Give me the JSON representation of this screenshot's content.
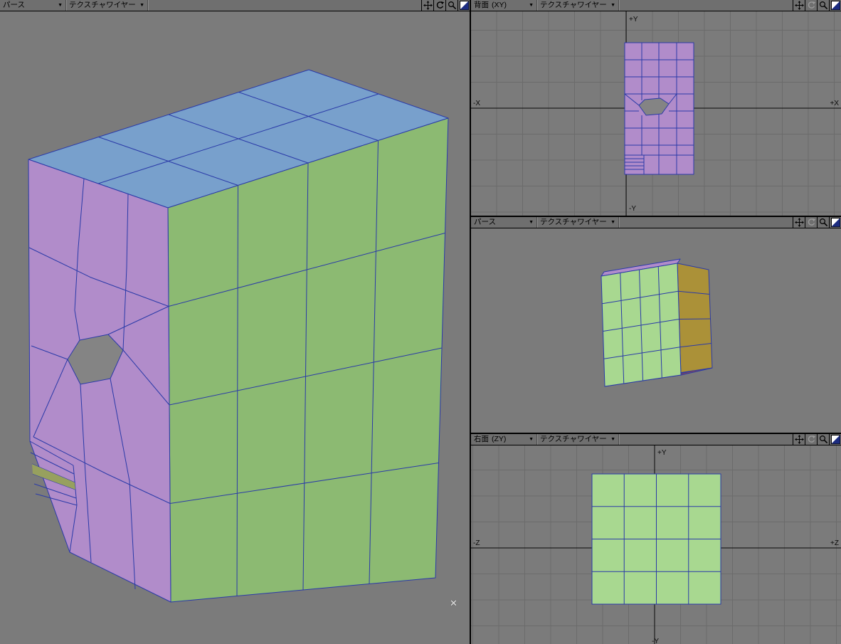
{
  "colors": {
    "viewport_bg": "#7b7b7b",
    "header_bg": "#6f6f6f",
    "grid_line": "#6b6b6b",
    "wire": "#2a3aa8",
    "axis": "#0a0a0a",
    "face_purple": "#b18cca",
    "face_blue": "#78a0cc",
    "face_green": "#8cba72",
    "face_light_green": "#a8d890",
    "face_olive": "#ab9138",
    "face_red": "#94494b",
    "hole_gray": "#848484",
    "stair_sliver": "#97a05e"
  },
  "icons": {
    "dropdown_arrow": "▼"
  },
  "cursor_mark": "✕",
  "viewports": {
    "perspective_main": {
      "view_label": "パース",
      "display_label": "テクスチャワイヤー"
    },
    "back": {
      "view_label": "背面",
      "axis_suffix": "(XY)",
      "display_label": "テクスチャワイヤー",
      "axes": {
        "top": "+Y",
        "left": "-X",
        "right": "+X",
        "bottom": "-Y"
      }
    },
    "perspective_sub": {
      "view_label": "パース",
      "display_label": "テクスチャワイヤー"
    },
    "right": {
      "view_label": "右面",
      "axis_suffix": "(ZY)",
      "display_label": "テクスチャワイヤー",
      "axes": {
        "top": "+Y",
        "left": "-Z",
        "right": "+Z",
        "bottom": "-Y"
      }
    }
  }
}
